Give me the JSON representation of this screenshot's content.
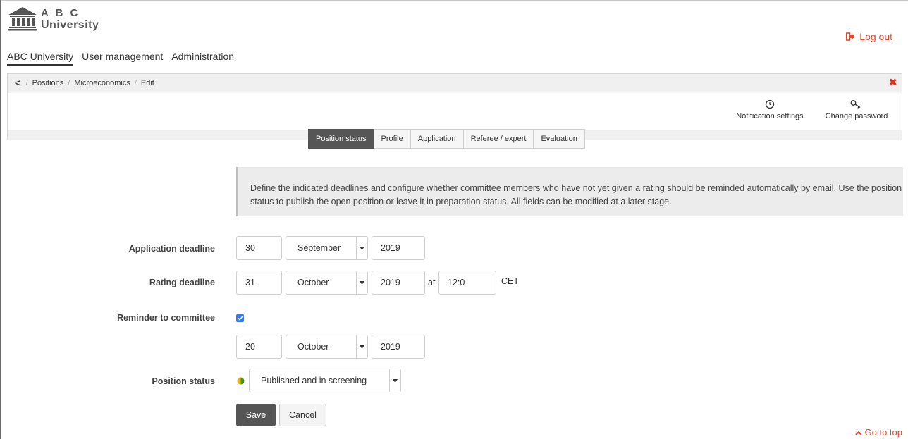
{
  "header": {
    "logo_line1": "A B C",
    "logo_line2": "University",
    "logout_label": "Log out"
  },
  "nav": {
    "items": [
      "ABC University",
      "User management",
      "Administration"
    ]
  },
  "breadcrumb": {
    "back": "<",
    "items": [
      "Positions",
      "Microeconomics",
      "Edit"
    ]
  },
  "toolbar": {
    "notification_settings": "Notification settings",
    "change_password": "Change password"
  },
  "tabs": [
    {
      "label": "Position status",
      "active": true
    },
    {
      "label": "Profile",
      "active": false
    },
    {
      "label": "Application",
      "active": false
    },
    {
      "label": "Referee / expert",
      "active": false
    },
    {
      "label": "Evaluation",
      "active": false
    }
  ],
  "info_text": "Define the indicated deadlines and configure whether committee members who have not yet given a rating should be reminded automatically by email. Use the position status to publish the open position or leave it in preparation status. All fields can be modified at a later stage.",
  "form": {
    "application_deadline": {
      "label": "Application deadline",
      "day": "30",
      "month": "September",
      "year": "2019"
    },
    "rating_deadline": {
      "label": "Rating deadline",
      "day": "31",
      "month": "October",
      "year": "2019",
      "at": "at",
      "time": "12:0",
      "tz": "CET"
    },
    "reminder": {
      "label": "Reminder to committee",
      "checked": true,
      "day": "20",
      "month": "October",
      "year": "2019"
    },
    "position_status": {
      "label": "Position status",
      "value": "Published and in screening"
    }
  },
  "buttons": {
    "save": "Save",
    "cancel": "Cancel"
  },
  "footer": {
    "go_to_top": "Go to top"
  },
  "colors": {
    "accent": "#e2492c",
    "checkbox": "#3478f6",
    "active_tab": "#565656"
  }
}
